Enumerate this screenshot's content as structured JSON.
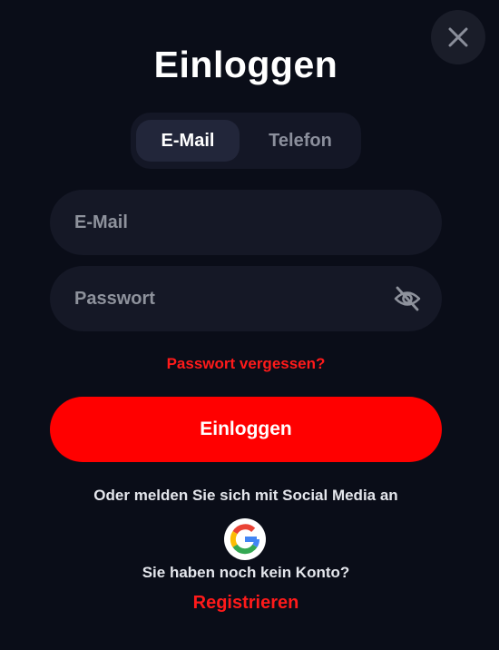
{
  "dialog": {
    "title": "Einloggen",
    "close_icon": "close-icon"
  },
  "tabs": [
    {
      "label": "E-Mail",
      "active": true
    },
    {
      "label": "Telefon",
      "active": false
    }
  ],
  "form": {
    "email_placeholder": "E-Mail",
    "email_value": "",
    "password_placeholder": "Passwort",
    "password_value": "",
    "password_toggle_icon": "eye-off-icon",
    "forgot_label": "Passwort vergessen?",
    "submit_label": "Einloggen"
  },
  "social": {
    "prompt": "Oder melden Sie sich mit Social Media an",
    "providers": [
      {
        "icon": "google-icon"
      }
    ]
  },
  "footer": {
    "no_account_text": "Sie haben noch kein Konto?",
    "register_label": "Registrieren"
  },
  "colors": {
    "background": "#0a0d18",
    "accent": "#ff0000",
    "field_bg": "#151826",
    "muted_text": "#8e929c"
  }
}
